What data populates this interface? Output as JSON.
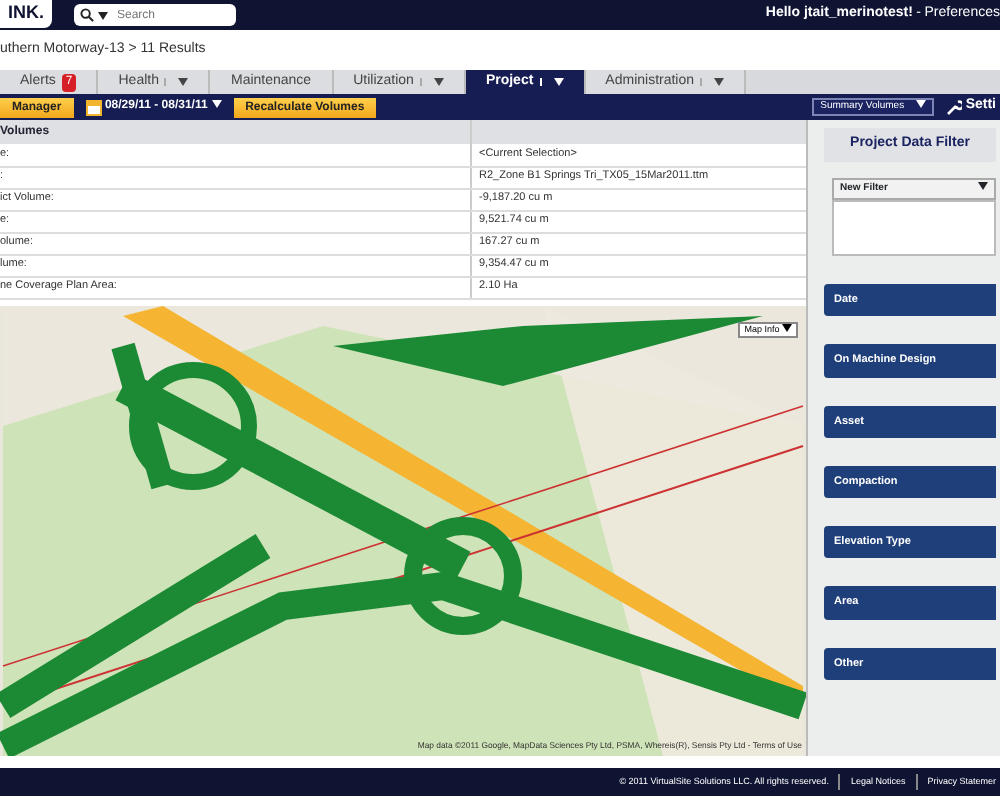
{
  "header": {
    "logo": "INK.",
    "search": {
      "placeholder": "Search"
    },
    "greeting": "Hello jtait_merinotest!",
    "separator": "-",
    "preferences": "Preferences"
  },
  "breadcrumb": "uthern Motorway-13 > 11 Results",
  "tabs": [
    {
      "label": "Alerts",
      "badge": "7",
      "dropdown": false,
      "selected": false
    },
    {
      "label": "Health",
      "dropdown": true,
      "selected": false
    },
    {
      "label": "Maintenance",
      "dropdown": false,
      "selected": false
    },
    {
      "label": "Utilization",
      "dropdown": true,
      "selected": false
    },
    {
      "label": "Project",
      "dropdown": true,
      "selected": true
    },
    {
      "label": "Administration",
      "dropdown": true,
      "selected": false
    }
  ],
  "toolbar": {
    "manager_button": "Manager",
    "date_range": "08/29/11 - 08/31/11",
    "recalculate_button": "Recalculate Volumes",
    "summary_select": "Summary Volumes",
    "settings": "Setti"
  },
  "volumes": {
    "title": "Volumes",
    "rows": [
      {
        "label": "e:",
        "value": "<Current Selection>"
      },
      {
        "label": ":",
        "value": "R2_Zone B1 Springs Tri_TX05_15Mar2011.ttm"
      },
      {
        "label": "ict Volume:",
        "value": "-9,187.20 cu m"
      },
      {
        "label": "e:",
        "value": "9,521.74 cu m"
      },
      {
        "label": "olume:",
        "value": "167.27 cu m"
      },
      {
        "label": "lume:",
        "value": "9,354.47 cu m"
      },
      {
        "label": "ne Coverage Plan Area:",
        "value": "2.10 Ha"
      }
    ]
  },
  "map": {
    "map_info_button": "Map Info",
    "attribution": "Map data ©2011  Google, MapData Sciences Pty Ltd, PSMA, Whereis(R), Sensis Pty Ltd -",
    "terms_link": "Terms of Use"
  },
  "filter_panel": {
    "title": "Project Data Filter",
    "filter_select": "New Filter",
    "sections": [
      "Date",
      "On Machine Design",
      "Asset",
      "Compaction",
      "Elevation Type",
      "Area",
      "Other"
    ]
  },
  "footer": {
    "copyright": "© 2011 VirtualSite Solutions LLC. All rights reserved.",
    "links": [
      "Legal Notices",
      "Privacy Statemer"
    ]
  }
}
